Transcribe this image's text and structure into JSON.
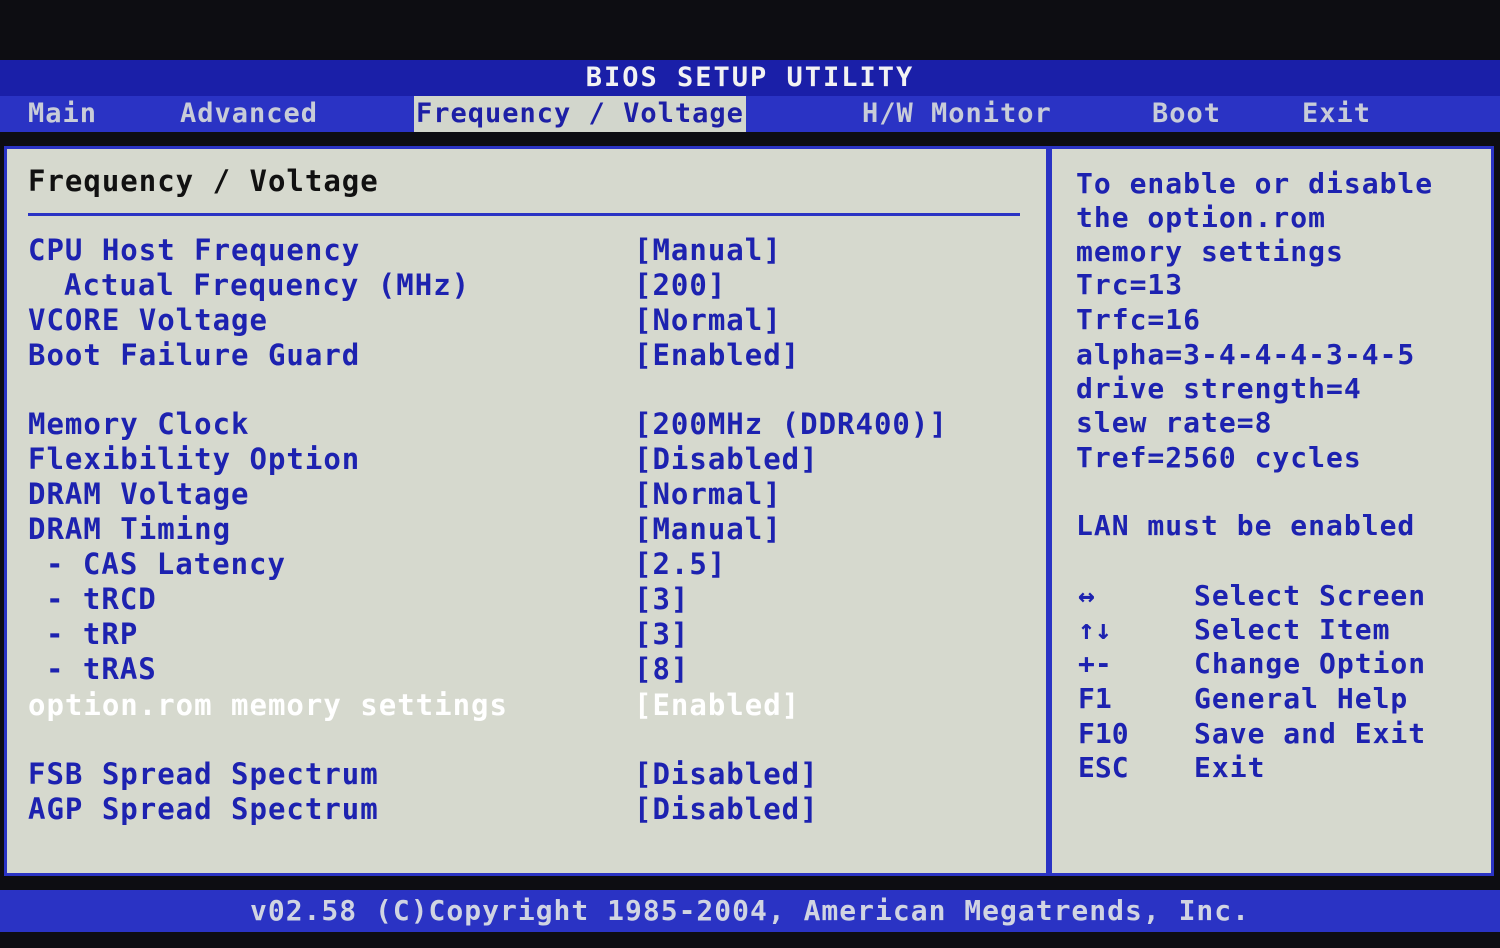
{
  "title": "BIOS SETUP UTILITY",
  "tabs": [
    {
      "label": "Main"
    },
    {
      "label": "Advanced"
    },
    {
      "label": "Frequency / Voltage"
    },
    {
      "label": "H/W Monitor"
    },
    {
      "label": "Boot"
    },
    {
      "label": "Exit"
    }
  ],
  "section_title": "Frequency / Voltage",
  "settings": [
    {
      "label": "CPU Host Frequency",
      "value": "[Manual]"
    },
    {
      "label": "Actual Frequency (MHz)",
      "value": "[200]"
    },
    {
      "label": "VCORE Voltage",
      "value": "[Normal]"
    },
    {
      "label": "Boot Failure Guard",
      "value": "[Enabled]"
    },
    {
      "label": "Memory Clock",
      "value": "[200MHz (DDR400)]"
    },
    {
      "label": "Flexibility Option",
      "value": "[Disabled]"
    },
    {
      "label": "DRAM Voltage",
      "value": "[Normal]"
    },
    {
      "label": "DRAM Timing",
      "value": "[Manual]"
    },
    {
      "label": "- CAS Latency",
      "value": "[2.5]"
    },
    {
      "label": "- tRCD",
      "value": "[3]"
    },
    {
      "label": "- tRP",
      "value": "[3]"
    },
    {
      "label": "- tRAS",
      "value": "[8]"
    },
    {
      "label": "option.rom memory settings",
      "value": "[Enabled]"
    },
    {
      "label": "FSB Spread Spectrum",
      "value": "[Disabled]"
    },
    {
      "label": "AGP Spread Spectrum",
      "value": "[Disabled]"
    }
  ],
  "help_text": [
    "To enable or disable",
    "the option.rom",
    "memory settings",
    "Trc=13",
    "Trfc=16",
    "alpha=3-4-4-4-3-4-5",
    "drive strength=4",
    "slew rate=8",
    "Tref=2560 cycles",
    "LAN must be enabled"
  ],
  "keys": [
    {
      "key": "↔",
      "desc": "Select Screen"
    },
    {
      "key": "↑↓",
      "desc": "Select Item"
    },
    {
      "key": "+-",
      "desc": "Change Option"
    },
    {
      "key": "F1",
      "desc": "General Help"
    },
    {
      "key": "F10",
      "desc": "Save and Exit"
    },
    {
      "key": "ESC",
      "desc": "Exit"
    }
  ],
  "footer": "v02.58 (C)Copyright 1985-2004, American Megatrends, Inc.",
  "colors": {
    "bar_blue": "#2a33c4",
    "panel_grey": "#d6d9ce",
    "text_blue": "#1d22b0",
    "highlight_white": "#ffffff"
  }
}
